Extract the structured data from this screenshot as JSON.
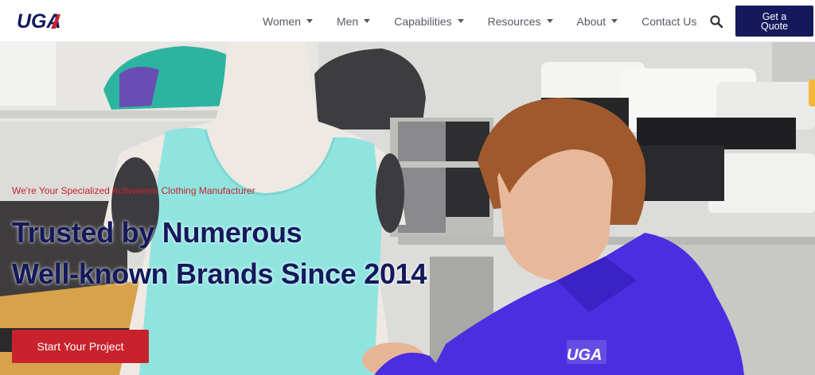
{
  "brand": {
    "logo_text": "UGA"
  },
  "nav": {
    "items": [
      {
        "label": "Women",
        "has_dropdown": true
      },
      {
        "label": "Men",
        "has_dropdown": true
      },
      {
        "label": "Capabilities",
        "has_dropdown": true
      },
      {
        "label": "Resources",
        "has_dropdown": true
      },
      {
        "label": "About",
        "has_dropdown": true
      },
      {
        "label": "Contact Us",
        "has_dropdown": false
      }
    ],
    "search_icon": "search-icon",
    "quote_button": "Get a Quote"
  },
  "hero": {
    "tagline": "We're Your Specialized Activewear Clothing Manufacturer",
    "headline_line1": "Trusted by Numerous",
    "headline_line2": "Well-known Brands Since 2014",
    "cta_label": "Start Your Project",
    "jacket_logo": "UGA"
  },
  "colors": {
    "brand_navy": "#14195c",
    "brand_red": "#c8232c",
    "nav_text": "#555a64",
    "side_tab": "#f4b63c"
  }
}
